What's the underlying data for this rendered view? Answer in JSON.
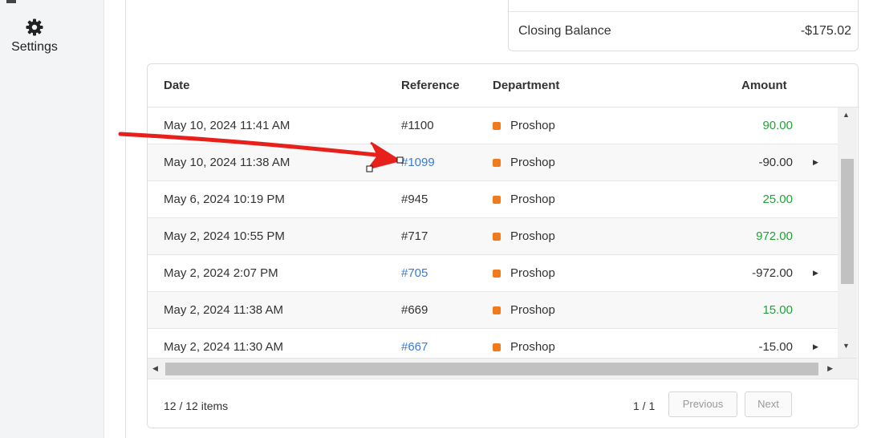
{
  "sidebar": {
    "settings_label": "Settings",
    "settings_icon": "gear-icon"
  },
  "summary": {
    "closing_balance_label": "Closing Balance",
    "closing_balance_value": "-$175.02"
  },
  "table": {
    "columns": {
      "date": "Date",
      "reference": "Reference",
      "department": "Department",
      "amount": "Amount"
    },
    "rows": [
      {
        "date": "May 10, 2024 11:41 AM",
        "reference": "#1100",
        "ref_link": false,
        "department": "Proshop",
        "amount": "90.00",
        "positive": true,
        "expandable": false
      },
      {
        "date": "May 10, 2024 11:38 AM",
        "reference": "#1099",
        "ref_link": true,
        "department": "Proshop",
        "amount": "-90.00",
        "positive": false,
        "expandable": true
      },
      {
        "date": "May 6, 2024 10:19 PM",
        "reference": "#945",
        "ref_link": false,
        "department": "Proshop",
        "amount": "25.00",
        "positive": true,
        "expandable": false
      },
      {
        "date": "May 2, 2024 10:55 PM",
        "reference": "#717",
        "ref_link": false,
        "department": "Proshop",
        "amount": "972.00",
        "positive": true,
        "expandable": false
      },
      {
        "date": "May 2, 2024 2:07 PM",
        "reference": "#705",
        "ref_link": true,
        "department": "Proshop",
        "amount": "-972.00",
        "positive": false,
        "expandable": true
      },
      {
        "date": "May 2, 2024 11:38 AM",
        "reference": "#669",
        "ref_link": false,
        "department": "Proshop",
        "amount": "15.00",
        "positive": true,
        "expandable": false
      },
      {
        "date": "May 2, 2024 11:30 AM",
        "reference": "#667",
        "ref_link": true,
        "department": "Proshop",
        "amount": "-15.00",
        "positive": false,
        "expandable": true
      }
    ]
  },
  "pagination": {
    "items_count": "12 / 12 items",
    "page_indicator": "1 / 1",
    "previous_label": "Previous",
    "next_label": "Next"
  },
  "colors": {
    "positive_amount": "#22a33a",
    "link": "#3a7bd5",
    "department_dot": "#f07b1d",
    "annotation_arrow": "#e8201c"
  }
}
